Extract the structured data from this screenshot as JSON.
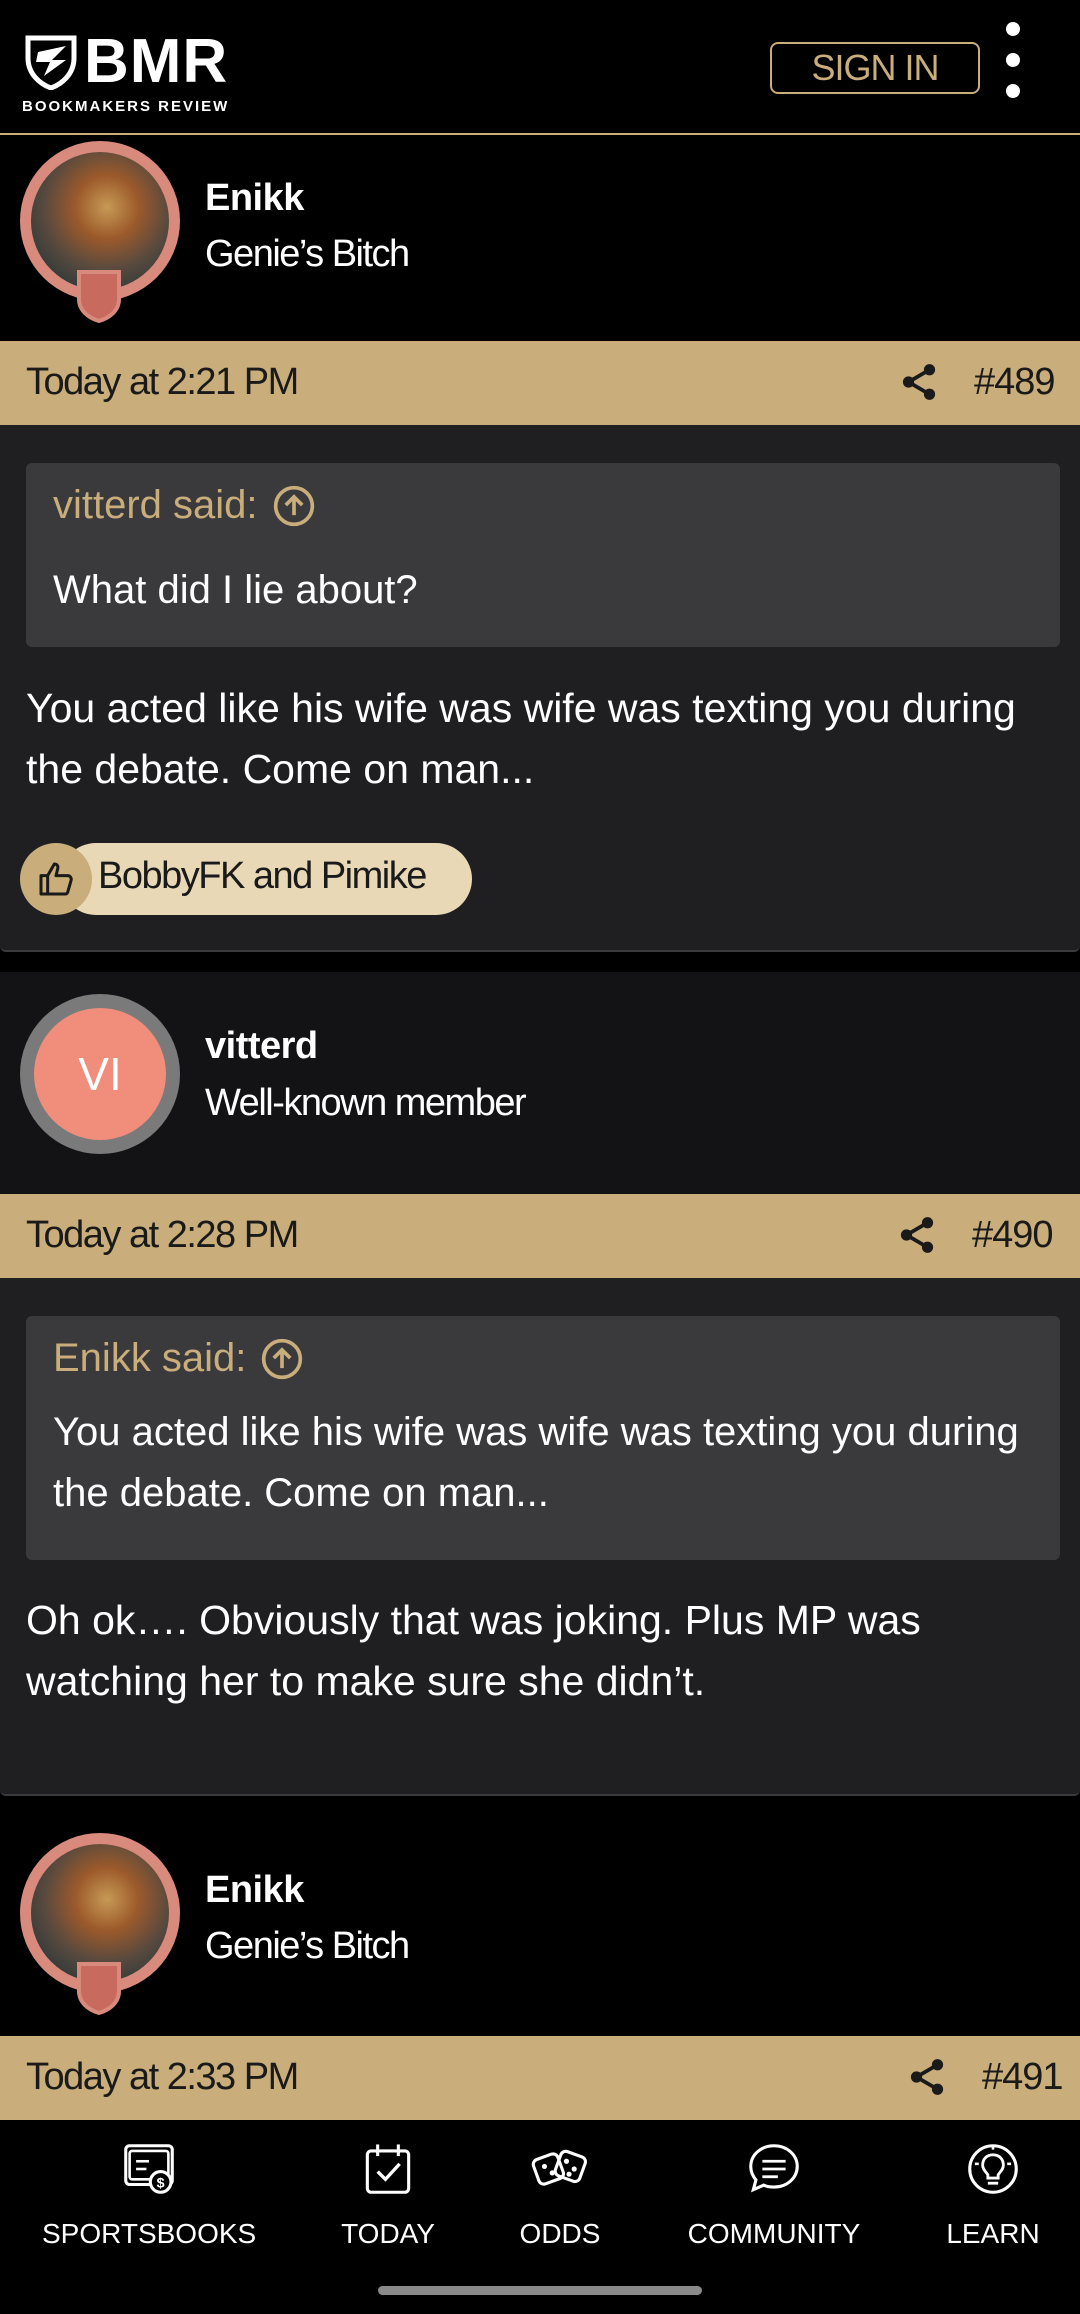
{
  "header": {
    "brand": "BMR",
    "tagline": "BOOKMAKERS REVIEW",
    "signin_label": "SIGN IN",
    "menu_icon": "more-vertical-icon"
  },
  "posts": [
    {
      "author": "Enikk",
      "author_title": "Genie’s Bitch",
      "time": "Today at 2:21 PM",
      "number": "#489",
      "quote_author": "vitterd said:",
      "quote_text": "What did I lie about?",
      "message": "You acted like his wife was wife was texting you during the debate. Come on man...",
      "reactions": "BobbyFK and Pimike"
    },
    {
      "author": "vitterd",
      "author_title": "Well-known member",
      "avatar_initials": "VI",
      "time": "Today at 2:28 PM",
      "number": "#490",
      "quote_author": "Enikk said:",
      "quote_text": "You acted like his wife was wife was texting you during the debate. Come on man...",
      "message": "Oh ok…. Obviously that was joking. Plus MP was watching her to make sure she didn’t."
    },
    {
      "author": "Enikk",
      "author_title": "Genie’s Bitch",
      "time": "Today at 2:33 PM",
      "number": "#491"
    }
  ],
  "nav": [
    {
      "label": "SPORTSBOOKS",
      "icon": "sportsbooks-icon"
    },
    {
      "label": "TODAY",
      "icon": "calendar-check-icon"
    },
    {
      "label": "ODDS",
      "icon": "dice-icon"
    },
    {
      "label": "COMMUNITY",
      "icon": "chat-bubble-icon"
    },
    {
      "label": "LEARN",
      "icon": "lightbulb-icon"
    }
  ],
  "colors": {
    "gold": "#c9ad7a",
    "post_bg": "#1f1f22",
    "quote_bg": "#3a3a3d",
    "avatar_vi": "#f08d7b"
  }
}
